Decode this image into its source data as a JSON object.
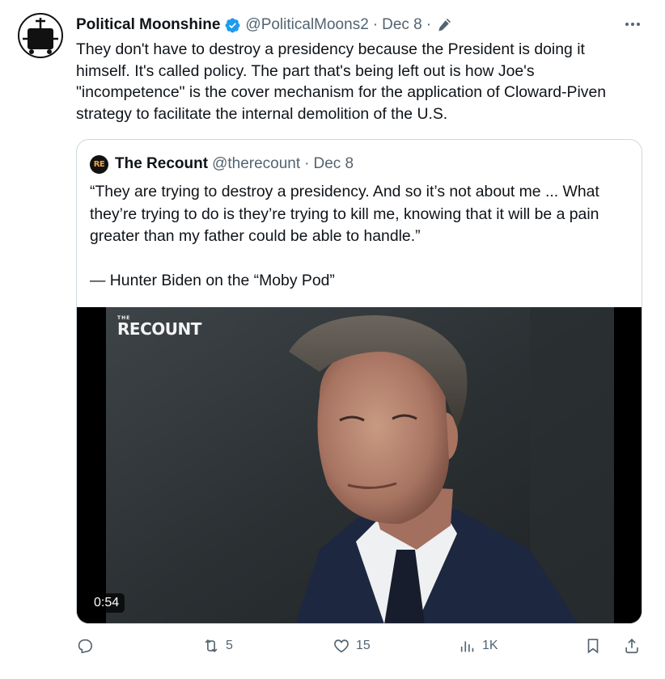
{
  "tweet": {
    "author_name": "Political Moonshine",
    "author_handle": "@PoliticalMoons2",
    "separator": "·",
    "date": "Dec 8",
    "text": "They don't have to destroy a presidency because the President is doing it himself. It's called policy. The part that's being left out is how Joe's \"incompetence\" is the cover mechanism for the application of Cloward-Piven strategy to facilitate the internal demolition of the U.S."
  },
  "quote": {
    "avatar_text": "RE",
    "author_name": "The Recount",
    "author_handle": "@therecount",
    "separator": "·",
    "date": "Dec 8",
    "text": "“They are trying to destroy a presidency. And so it’s not about me ... What they’re trying to do is they’re trying to kill me, knowing that it will be a pain greater than my father could be able to handle.”\n\n— Hunter Biden on the “Moby Pod”",
    "media": {
      "watermark_small": "THE",
      "watermark_big": "RECOUNT",
      "duration": "0:54"
    }
  },
  "actions": {
    "reply_count": "",
    "retweet_count": "5",
    "like_count": "15",
    "views_count": "1K"
  },
  "icons": [
    "verified-icon",
    "edit-pencil-icon",
    "more-icon",
    "reply-icon",
    "retweet-icon",
    "like-icon",
    "views-icon",
    "bookmark-icon",
    "share-icon"
  ],
  "colors": {
    "verified": "#1d9bf0",
    "secondary_text": "#536471",
    "border": "#cfd9de",
    "recount_accent": "#f2a641"
  }
}
